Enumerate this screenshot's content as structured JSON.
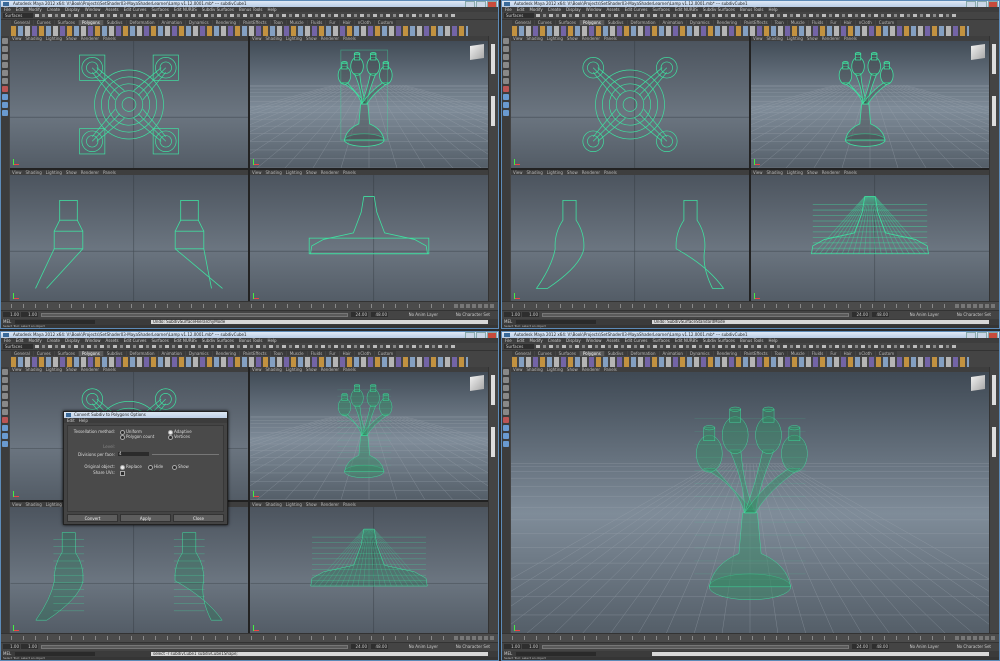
{
  "windows": [
    {
      "title": "Autodesk Maya 2012 x64: V:\\Book\\Projects\\SetShader03-MayaShaderLearner\\Lamp v1.12.0001.mb* --- subdivCube1",
      "menus": [
        "File",
        "Edit",
        "Modify",
        "Create",
        "Display",
        "Window",
        "Assets",
        "Edit Curves",
        "Surfaces",
        "Edit NURBS",
        "Subdiv Surfaces",
        "Bonus Tools",
        "Help"
      ],
      "mode": "Surfaces",
      "shelf_tabs": [
        "General",
        "Curves",
        "Surfaces",
        "Polygons",
        "Subdivs",
        "Deformation",
        "Animation",
        "Dynamics",
        "Rendering",
        "PaintEffects",
        "Toon",
        "Muscle",
        "Fluids",
        "Fur",
        "Hair",
        "nCloth",
        "Custom"
      ],
      "active_tab": "Polygons",
      "panel_menu": [
        "View",
        "Shading",
        "Lighting",
        "Show",
        "Renderer",
        "Panels"
      ],
      "time_start": "1.00",
      "time_end": "24.00",
      "range_end": "48.00",
      "anim_layer": "No Anim Layer",
      "char_set": "No Character Set",
      "command_result": "Undo: SubdivSurfaceHierarchyMode",
      "help": "Select Tool: select an object",
      "model_state": "cage"
    },
    {
      "title": "Autodesk Maya 2012 x64: V:\\Book\\Projects\\SetShader03-MayaShaderLearner\\Lamp v1.12.0001.mb* --- subdivCube1",
      "menus": [
        "File",
        "Edit",
        "Modify",
        "Create",
        "Display",
        "Window",
        "Assets",
        "Edit Curves",
        "Surfaces",
        "Edit NURBS",
        "Subdiv Surfaces",
        "Bonus Tools",
        "Help"
      ],
      "mode": "Surfaces",
      "shelf_tabs": [
        "General",
        "Curves",
        "Surfaces",
        "Polygons",
        "Subdivs",
        "Deformation",
        "Animation",
        "Dynamics",
        "Rendering",
        "PaintEffects",
        "Toon",
        "Muscle",
        "Fluids",
        "Fur",
        "Hair",
        "nCloth",
        "Custom"
      ],
      "active_tab": "Polygons",
      "panel_menu": [
        "View",
        "Shading",
        "Lighting",
        "Show",
        "Renderer",
        "Panels"
      ],
      "time_start": "1.00",
      "time_end": "24.00",
      "range_end": "48.00",
      "anim_layer": "No Anim Layer",
      "char_set": "No Character Set",
      "command_result": "Undo: SubdivSurfaceStandardMode",
      "help": "Select Tool: select an object",
      "model_state": "smooth-cage"
    },
    {
      "title": "Autodesk Maya 2012 x64: V:\\Book\\Projects\\SetShader03-MayaShaderLearner\\Lamp v1.12.0001.mb* --- subdivCube1",
      "menus": [
        "File",
        "Edit",
        "Modify",
        "Create",
        "Display",
        "Window",
        "Assets",
        "Edit Curves",
        "Surfaces",
        "Edit NURBS",
        "Subdiv Surfaces",
        "Bonus Tools",
        "Help"
      ],
      "mode": "Surfaces",
      "shelf_tabs": [
        "General",
        "Curves",
        "Surfaces",
        "Polygons",
        "Subdivs",
        "Deformation",
        "Animation",
        "Dynamics",
        "Rendering",
        "PaintEffects",
        "Toon",
        "Muscle",
        "Fluids",
        "Fur",
        "Hair",
        "nCloth",
        "Custom"
      ],
      "active_tab": "Polygons",
      "panel_menu": [
        "View",
        "Shading",
        "Lighting",
        "Show",
        "Renderer",
        "Panels"
      ],
      "time_start": "1.00",
      "time_end": "24.00",
      "range_end": "48.00",
      "anim_layer": "No Anim Layer",
      "char_set": "No Character Set",
      "command_result": "select -r subdivCube1 subdivCube1Shape;",
      "help": "Select Tool: select an object",
      "model_state": "mesh"
    },
    {
      "title": "Autodesk Maya 2012 x64: V:\\Book\\Projects\\SetShader03-MayaShaderLearner\\Lamp v1.12.0001.mb* --- subdivCube1",
      "menus": [
        "File",
        "Edit",
        "Modify",
        "Create",
        "Display",
        "Window",
        "Assets",
        "Edit Curves",
        "Surfaces",
        "Edit NURBS",
        "Subdiv Surfaces",
        "Bonus Tools",
        "Help"
      ],
      "mode": "Surfaces",
      "shelf_tabs": [
        "General",
        "Curves",
        "Surfaces",
        "Polygons",
        "Subdivs",
        "Deformation",
        "Animation",
        "Dynamics",
        "Rendering",
        "PaintEffects",
        "Toon",
        "Muscle",
        "Fluids",
        "Fur",
        "Hair",
        "nCloth",
        "Custom"
      ],
      "active_tab": "Polygons",
      "panel_menu": [
        "View",
        "Shading",
        "Lighting",
        "Show",
        "Renderer",
        "Panels"
      ],
      "time_start": "1.00",
      "time_end": "24.00",
      "range_end": "48.00",
      "anim_layer": "No Anim Layer",
      "char_set": "No Character Set",
      "command_result": "",
      "help": "Select Tool: select an object",
      "model_state": "mesh"
    }
  ],
  "dialog": {
    "title": "Convert Subdiv to Polygons Options",
    "menus": [
      "Edit",
      "Help"
    ],
    "tessellation_label": "Tessellation method:",
    "opt_uniform": "Uniform",
    "opt_adaptive": "Adaptive",
    "opt_polygon_count": "Polygon count",
    "opt_vertices": "Vertices",
    "level_label": "Level:",
    "divisions_label": "Divisions per face:",
    "divisions_value": "4",
    "original_object_label": "Original object:",
    "opt_replace": "Replace",
    "opt_hide": "Hide",
    "opt_show": "Show",
    "share_uvs_label": "Share UVs:",
    "btn_convert": "Convert",
    "btn_apply": "Apply",
    "btn_close": "Close"
  },
  "colors": {
    "wire": "#3fe0a0",
    "mesh_fill": "#2a5a4a"
  }
}
